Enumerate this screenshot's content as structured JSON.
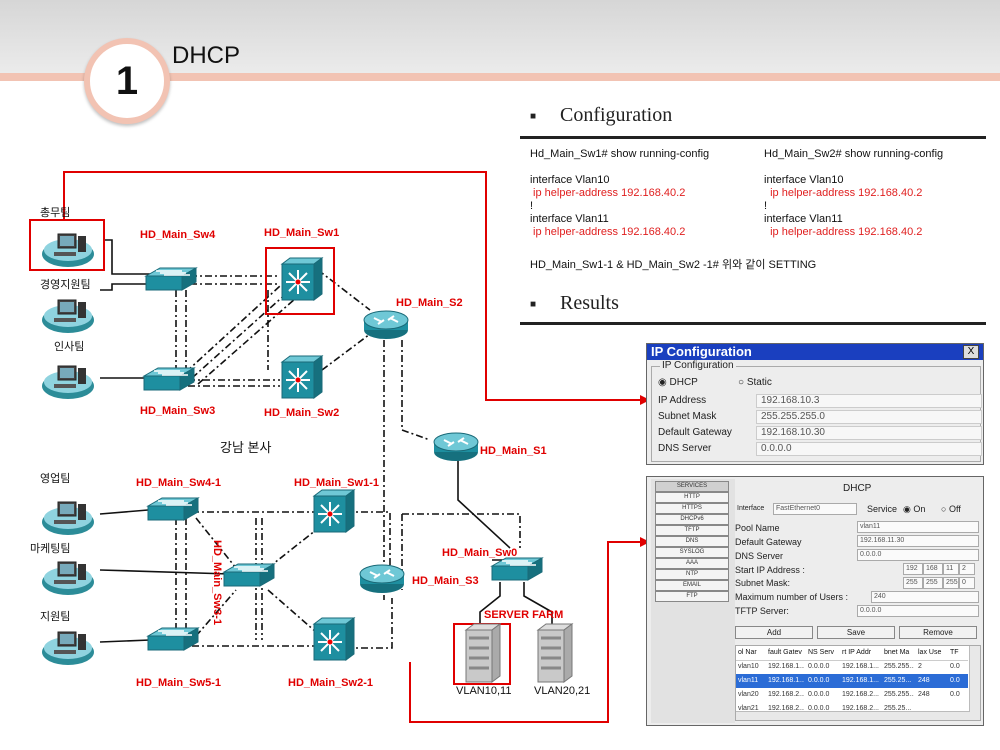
{
  "header": {
    "number": "1",
    "title": "DHCP"
  },
  "config": {
    "heading": "Configuration",
    "sw1": {
      "cmd": "Hd_Main_Sw1# show running-config",
      "iface1": "interface Vlan10",
      "helper1": " ip helper-address 192.168.40.2",
      "bang": "!",
      "iface2": "interface Vlan11",
      "helper2": " ip helper-address 192.168.40.2"
    },
    "sw2": {
      "cmd": "Hd_Main_Sw2# show running-config",
      "iface1": "interface Vlan10",
      "helper1": "  ip helper-address 192.168.40.2",
      "bang": "!",
      "iface2": "interface Vlan11",
      "helper2": "  ip helper-address 192.168.40.2"
    },
    "note": "HD_Main_Sw1-1 & HD_Main_Sw2 -1# 위와 같이 SETTING"
  },
  "results": {
    "heading": "Results"
  },
  "diagram": {
    "hq_label": "강남 본사",
    "devices": {
      "sw4": "HD_Main_Sw4",
      "sw1": "HD_Main_Sw1",
      "s2": "HD_Main_S2",
      "sw3": "HD_Main_Sw3",
      "sw2": "HD_Main_Sw2",
      "s1": "HD_Main_S1",
      "sw41": "HD_Main_Sw4-1",
      "sw11": "HD_Main_Sw1-1",
      "sw31": "HD_Main_Sw3-1",
      "sw0": "HD_Main_Sw0",
      "s3": "HD_Main_S3",
      "sw51": "HD_Main_Sw5-1",
      "sw21": "HD_Main_Sw2-1",
      "farm": "SERVER FARM"
    },
    "teams": [
      "총무팀",
      "경영지원팀",
      "인사팀",
      "영업팀",
      "마케팅팀",
      "지원팀"
    ],
    "servers": [
      "VLAN10,11",
      "VLAN20,21"
    ],
    "colors": {
      "red": "#e00000",
      "device": "#1e8fa0"
    }
  },
  "ip_config": {
    "title": "IP Configuration",
    "close": "X",
    "group": "IP Configuration",
    "dhcp": "DHCP",
    "static": "Static",
    "rows": [
      {
        "label": "IP Address",
        "value": "192.168.10.3"
      },
      {
        "label": "Subnet Mask",
        "value": "255.255.255.0"
      },
      {
        "label": "Default Gateway",
        "value": "192.168.10.30"
      },
      {
        "label": "DNS Server",
        "value": "0.0.0.0"
      }
    ]
  },
  "dhcp": {
    "title": "DHCP",
    "services": [
      "SERVICES",
      "HTTP",
      "HTTPS",
      "DHCPv6",
      "TFTP",
      "DNS",
      "SYSLOG",
      "AAA",
      "NTP",
      "EMAIL",
      "FTP"
    ],
    "interface_label": "Interface",
    "interface_value": "FastEthernet0",
    "service_label": "Service",
    "on": "On",
    "off": "Off",
    "fields": [
      {
        "label": "Pool Name",
        "value": "vlan11"
      },
      {
        "label": "Default Gateway",
        "value": "192.168.11.30"
      },
      {
        "label": "DNS Server",
        "value": "0.0.0.0"
      }
    ],
    "start_ip_label": "Start IP Address :",
    "start_ip": [
      "192",
      "168",
      "11",
      "2"
    ],
    "subnet_label": "Subnet Mask:",
    "subnet": [
      "255",
      "255",
      "255",
      "0"
    ],
    "max_users_label": "Maximum number of Users :",
    "max_users": "240",
    "tftp_label": "TFTP Server:",
    "tftp": "0.0.0.0",
    "buttons": {
      "add": "Add",
      "save": "Save",
      "remove": "Remove"
    },
    "columns": [
      "ol Nar",
      "fault Gatev",
      "NS Serv",
      "rt IP Addr",
      "bnet Ma",
      "lax Use",
      "TF"
    ],
    "rows": [
      [
        "vlan10",
        "192.168.1...",
        "0.0.0.0",
        "192.168.1...",
        "255.255...",
        "2",
        "0.0"
      ],
      [
        "vlan11",
        "192.168.1...",
        "0.0.0.0",
        "192.168.1...",
        "255.25...",
        "248",
        "0.0"
      ],
      [
        "vlan20",
        "192.168.2...",
        "0.0.0.0",
        "192.168.2...",
        "255.255...",
        "248",
        "0.0"
      ],
      [
        "vlan21",
        "192.168.2...",
        "0.0.0.0",
        "192.168.2...",
        "255.25...",
        "",
        ""
      ]
    ]
  }
}
